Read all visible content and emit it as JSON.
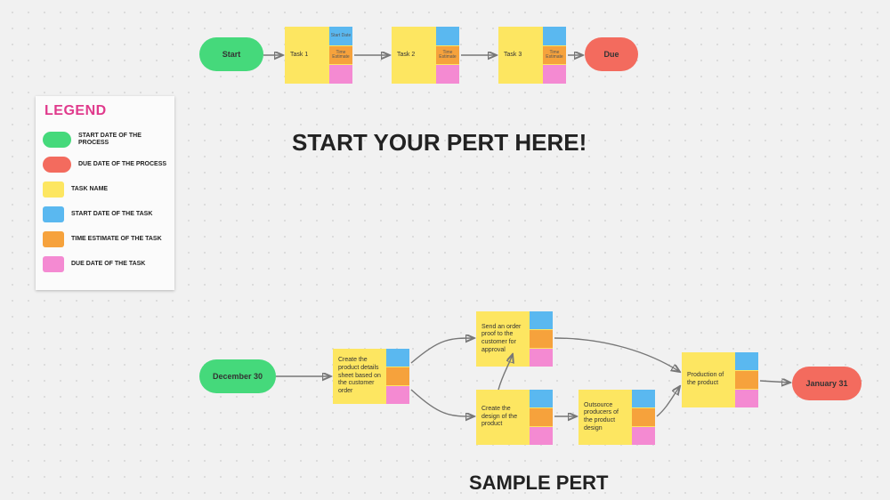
{
  "legend": {
    "title": "LEGEND",
    "items": [
      {
        "label": "START DATE OF THE PROCESS",
        "color": "#45d97b",
        "pill": true
      },
      {
        "label": "DUE DATE OF THE PROCESS",
        "color": "#f36b5e",
        "pill": true
      },
      {
        "label": "TASK NAME",
        "color": "#fde661",
        "pill": false
      },
      {
        "label": "START DATE OF THE TASK",
        "color": "#5ab8f0",
        "pill": false
      },
      {
        "label": "TIME ESTIMATE OF THE TASK",
        "color": "#f6a23c",
        "pill": false
      },
      {
        "label": "DUE DATE OF THE TASK",
        "color": "#f48ad2",
        "pill": false
      }
    ]
  },
  "headings": {
    "main": "START YOUR PERT HERE!",
    "sample": "SAMPLE PERT"
  },
  "top": {
    "start": "Start",
    "due": "Due",
    "tasks": [
      {
        "name": "Task 1",
        "start": "Start Date",
        "estimate": "Time Estimate",
        "due": ""
      },
      {
        "name": "Task 2",
        "start": "",
        "estimate": "Time Estimate",
        "due": ""
      },
      {
        "name": "Task 3",
        "start": "",
        "estimate": "Time Estimate",
        "due": ""
      }
    ]
  },
  "sample": {
    "start": "December 30",
    "due": "January 31",
    "tasks": {
      "create_sheet": {
        "name": "Create the product details sheet based on the customer order",
        "start": "",
        "estimate": "",
        "due": ""
      },
      "send_proof": {
        "name": "Send an order proof to the customer for approval",
        "start": "",
        "estimate": "",
        "due": ""
      },
      "create_design": {
        "name": "Create the design of the product",
        "start": "",
        "estimate": "",
        "due": ""
      },
      "outsource": {
        "name": "Outsource producers of the product design",
        "start": "",
        "estimate": "",
        "due": ""
      },
      "production": {
        "name": "Production of the product",
        "start": "",
        "estimate": "",
        "due": ""
      }
    }
  }
}
